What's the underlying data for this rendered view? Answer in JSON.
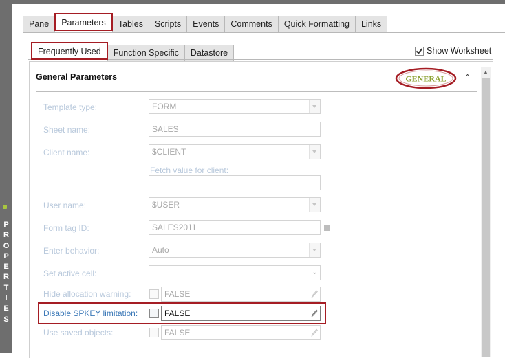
{
  "sidebar": {
    "letters": [
      "P",
      "R",
      "O",
      "P",
      "E",
      "R",
      "T",
      "I",
      "E",
      "S"
    ]
  },
  "tabs_main": [
    "Pane",
    "Parameters",
    "Tables",
    "Scripts",
    "Events",
    "Comments",
    "Quick Formatting",
    "Links"
  ],
  "tabs_main_active": "Parameters",
  "tabs_sub": [
    "Frequently Used",
    "Function Specific",
    "Datastore"
  ],
  "tabs_sub_active": "Frequently Used",
  "show_worksheet": {
    "label": "Show Worksheet",
    "checked": true
  },
  "section": {
    "title": "General Parameters",
    "logo_text": "GENERAL",
    "colors": {
      "logo_ring": "#a51d24",
      "logo_text": "#8da234"
    }
  },
  "fields": {
    "template_type": {
      "label": "Template type:",
      "value": "FORM"
    },
    "sheet_name": {
      "label": "Sheet name:",
      "value": "SALES"
    },
    "client_name": {
      "label": "Client name:",
      "value": "$CLIENT"
    },
    "fetch_value": {
      "label": "Fetch value for client:",
      "value": ""
    },
    "user_name": {
      "label": "User name:",
      "value": "$USER"
    },
    "form_tag_id": {
      "label": "Form tag ID:",
      "value": "SALES2011"
    },
    "enter_behavior": {
      "label": "Enter behavior:",
      "value": "Auto"
    },
    "set_active_cell": {
      "label": "Set active cell:",
      "value": ""
    },
    "hide_allocation_warning": {
      "label": "Hide allocation warning:",
      "value": "FALSE"
    },
    "disable_spkey": {
      "label": "Disable SPKEY limitation:",
      "value": "FALSE"
    },
    "use_saved_objects": {
      "label": "Use saved objects:",
      "value": "FALSE"
    }
  },
  "colors": {
    "accent": "#a51d24",
    "active_label": "#3c79b8",
    "disabled_label": "#b9c9dc"
  }
}
